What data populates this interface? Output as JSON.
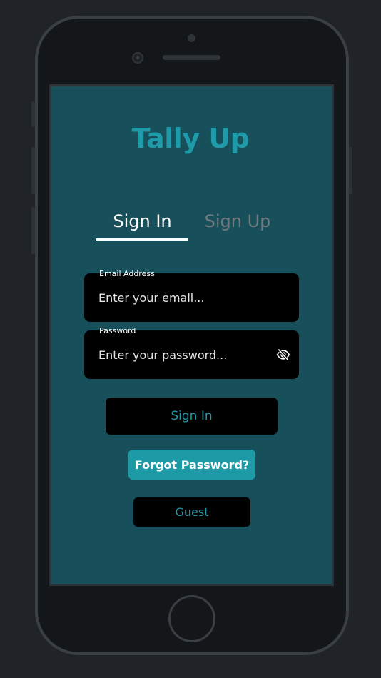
{
  "app": {
    "title": "Tally Up"
  },
  "tabs": [
    {
      "label": "Sign In",
      "active": true
    },
    {
      "label": "Sign Up",
      "active": false
    }
  ],
  "form": {
    "email": {
      "label": "Email Address",
      "placeholder": "Enter your email...",
      "value": ""
    },
    "password": {
      "label": "Password",
      "placeholder": "Enter your password...",
      "value": "",
      "toggle_icon": "eye-off-icon"
    }
  },
  "buttons": {
    "sign_in": "Sign In",
    "forgot_password": "Forgot Password?",
    "guest": "Guest"
  },
  "colors": {
    "screen_bg": "#174f5b",
    "accent": "#1e9aa8",
    "field_bg": "#000000",
    "device_bg": "#141719",
    "page_bg": "#202428"
  }
}
